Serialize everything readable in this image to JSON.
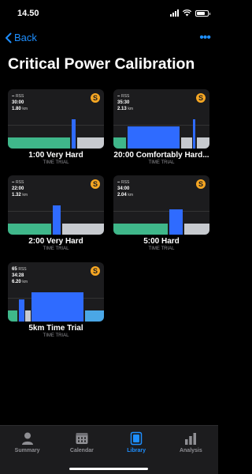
{
  "status_bar": {
    "time": "14.50"
  },
  "nav": {
    "back_label": "Back"
  },
  "page": {
    "title": "Critical Power Calibration"
  },
  "workouts": [
    {
      "title": "1:00 Very Hard",
      "subtitle": "TIME TRIAL",
      "rss": "–",
      "rss_label": "RSS",
      "duration": "30:00",
      "distance": "1.80",
      "distance_unit": "km",
      "badge": "S"
    },
    {
      "title": "20:00 Comfortably Hard...",
      "subtitle": "TIME TRIAL",
      "rss": "–",
      "rss_label": "RSS",
      "duration": "35:30",
      "distance": "2.13",
      "distance_unit": "km",
      "badge": "S"
    },
    {
      "title": "2:00 Very Hard",
      "subtitle": "TIME TRIAL",
      "rss": "–",
      "rss_label": "RSS",
      "duration": "22:00",
      "distance": "1.32",
      "distance_unit": "km",
      "badge": "S"
    },
    {
      "title": "5:00 Hard",
      "subtitle": "TIME TRIAL",
      "rss": "–",
      "rss_label": "RSS",
      "duration": "34:00",
      "distance": "2.04",
      "distance_unit": "km",
      "badge": "S"
    },
    {
      "title": "5km Time Trial",
      "subtitle": "TIME TRIAL",
      "rss": "65",
      "rss_label": "RSS",
      "duration": "34:28",
      "distance": "6.20",
      "distance_unit": "km",
      "badge": "S"
    }
  ],
  "tab_bar": {
    "summary": "Summary",
    "calendar": "Calendar",
    "library": "Library",
    "analysis": "Analysis",
    "active": "library"
  },
  "colors": {
    "accent": "#1e8fff",
    "warmup": "#3fb78a",
    "effort": "#2f6bff",
    "cooldown": "#c7cacf",
    "cooldown_blue": "#4aa7e6",
    "badge": "#f5a623"
  }
}
